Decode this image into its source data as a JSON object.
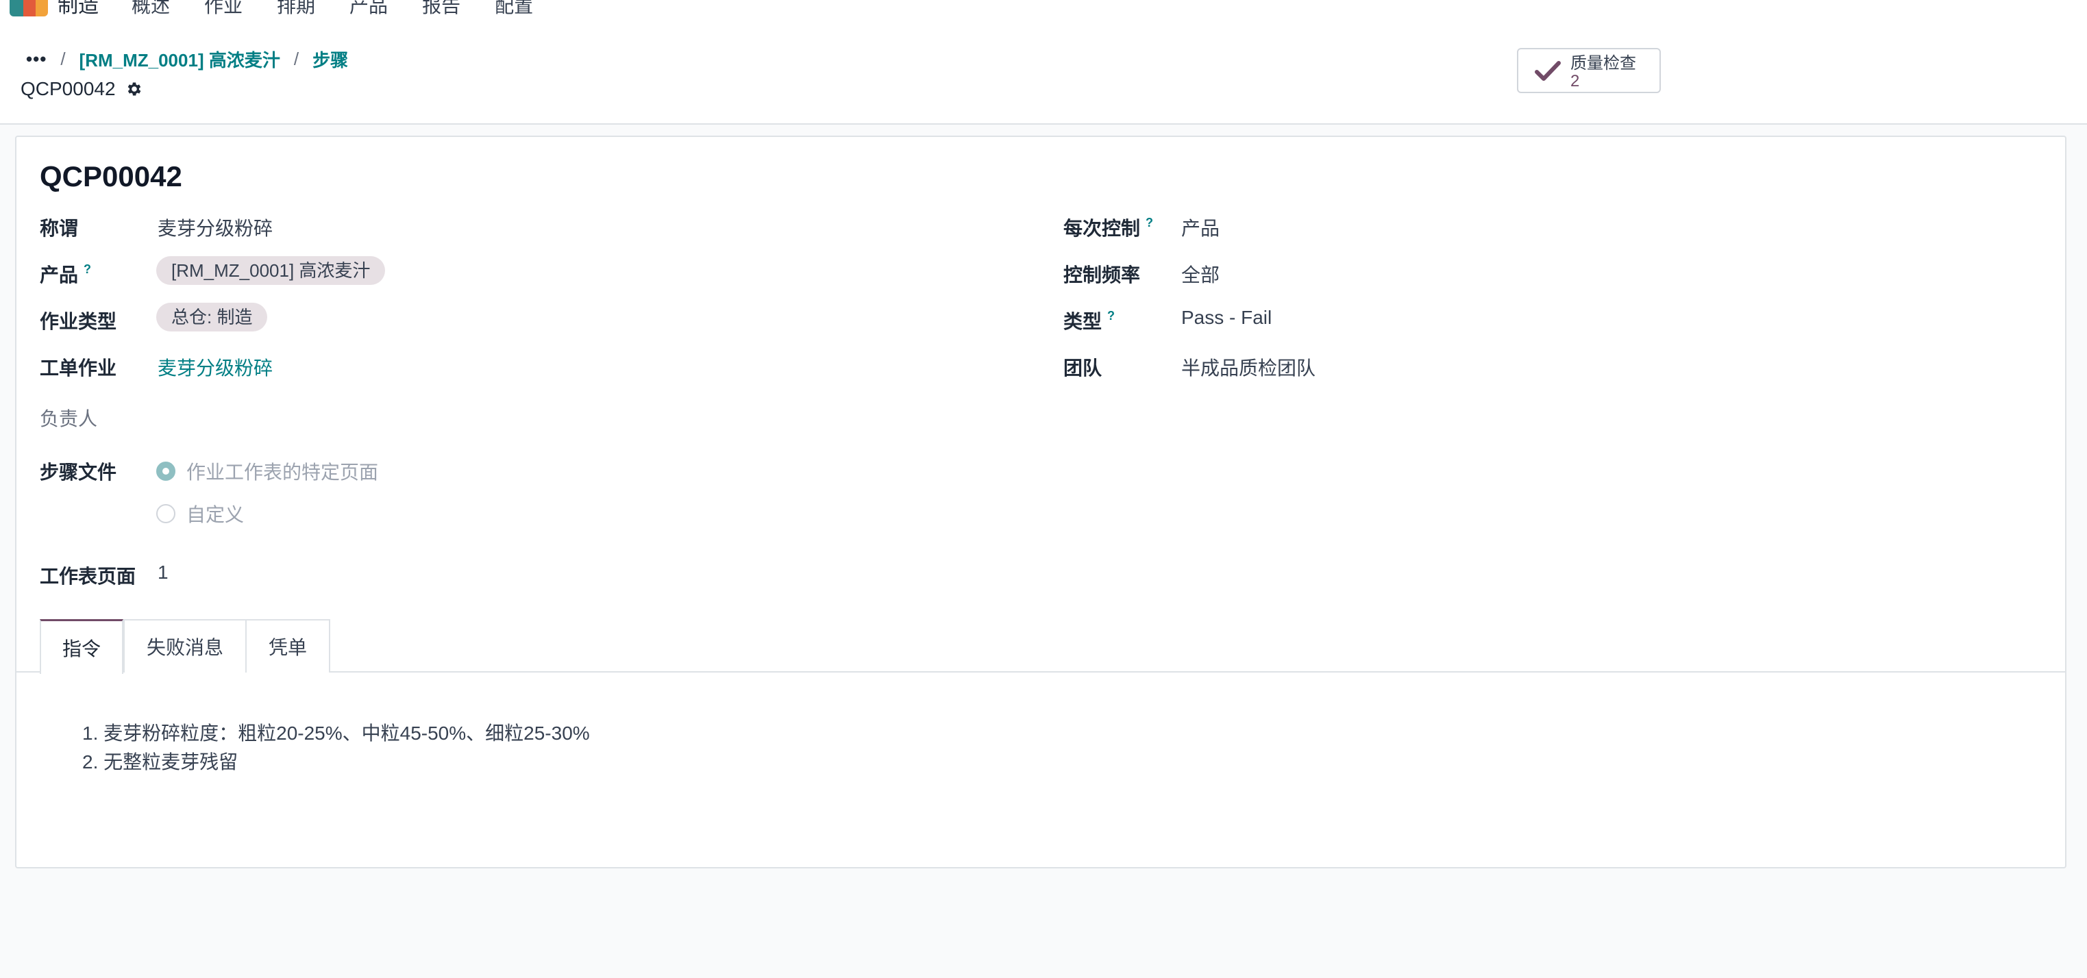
{
  "nav": {
    "app_name": "制造",
    "menu": [
      "概述",
      "作业",
      "排期",
      "产品",
      "报告",
      "配置"
    ]
  },
  "breadcrumb": {
    "dots": "•••",
    "items": [
      "[RM_MZ_0001] 高浓麦汁",
      "步骤"
    ],
    "current": "QCP00042"
  },
  "smart_button": {
    "label": "质量检查",
    "count": "2"
  },
  "form": {
    "title": "QCP00042",
    "left": {
      "name_label": "称谓",
      "name_value": "麦芽分级粉碎",
      "product_label": "产品",
      "product_value": "[RM_MZ_0001] 高浓麦汁",
      "op_type_label": "作业类型",
      "op_type_value": "总仓: 制造",
      "work_order_label": "工单作业",
      "work_order_value": "麦芽分级粉碎",
      "responsible_label": "负责人",
      "step_doc_label": "步骤文件",
      "step_doc_options": [
        "作业工作表的特定页面",
        "自定义"
      ],
      "sheet_page_label": "工作表页面",
      "sheet_page_value": "1"
    },
    "right": {
      "control_per_label": "每次控制",
      "control_per_value": "产品",
      "frequency_label": "控制频率",
      "frequency_value": "全部",
      "type_label": "类型",
      "type_value": "Pass - Fail",
      "team_label": "团队",
      "team_value": "半成品质检团队"
    },
    "help_mark": "?",
    "tabs": [
      "指令",
      "失败消息",
      "凭单"
    ],
    "instructions": [
      "1. 麦芽粉碎粒度：粗粒20-25%、中粒45-50%、细粒25-30%",
      "2. 无整粒麦芽残留"
    ]
  },
  "colors": {
    "accent": "#714b67",
    "link": "#017e84",
    "tag_bg": "#e7e0e4"
  }
}
